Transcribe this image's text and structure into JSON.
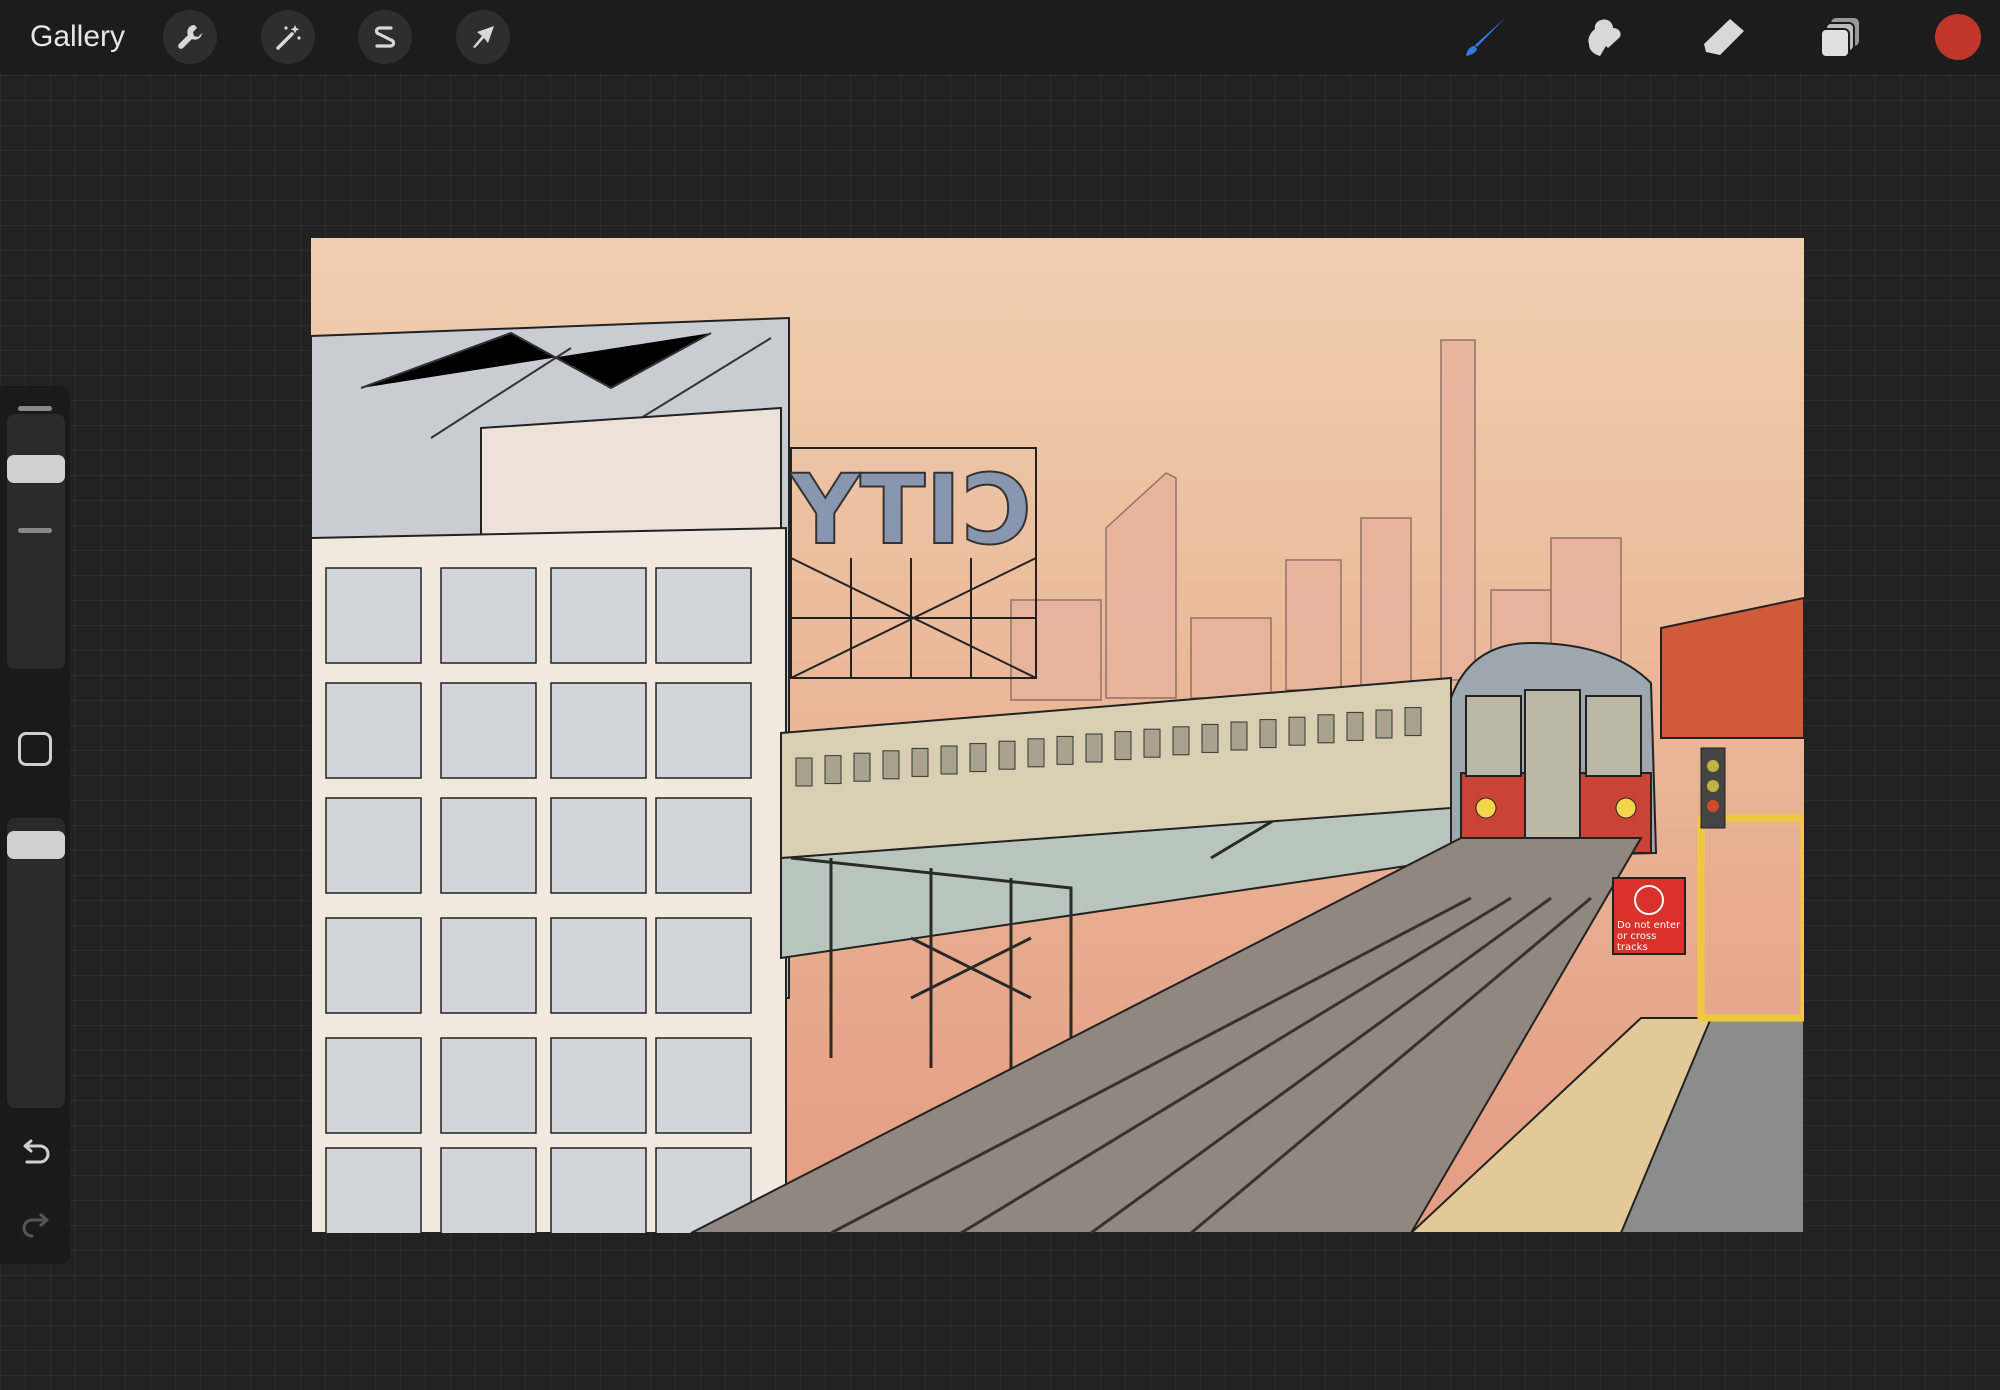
{
  "topbar": {
    "gallery_label": "Gallery",
    "left_tools": [
      {
        "name": "wrench-icon",
        "role": "Actions"
      },
      {
        "name": "magic-wand-icon",
        "role": "Adjustments"
      },
      {
        "name": "selection-s-icon",
        "role": "Selection"
      },
      {
        "name": "arrow-cursor-icon",
        "role": "Transform"
      }
    ],
    "right_tools": [
      {
        "name": "brush-icon",
        "role": "Paint",
        "active": true
      },
      {
        "name": "smudge-icon",
        "role": "Smudge"
      },
      {
        "name": "eraser-icon",
        "role": "Erase"
      },
      {
        "name": "layers-icon",
        "role": "Layers"
      }
    ],
    "current_color": "#c0362a",
    "active_tool_color": "#2f7de1"
  },
  "sidebar": {
    "brush_size_level": 0.18,
    "opacity_level": 0.05,
    "modify_button": "square-icon",
    "undo": "undo-icon",
    "redo": "redo-icon"
  },
  "artwork": {
    "sign_text": "Do not enter or cross tracks",
    "billboard_text": "CITY"
  }
}
